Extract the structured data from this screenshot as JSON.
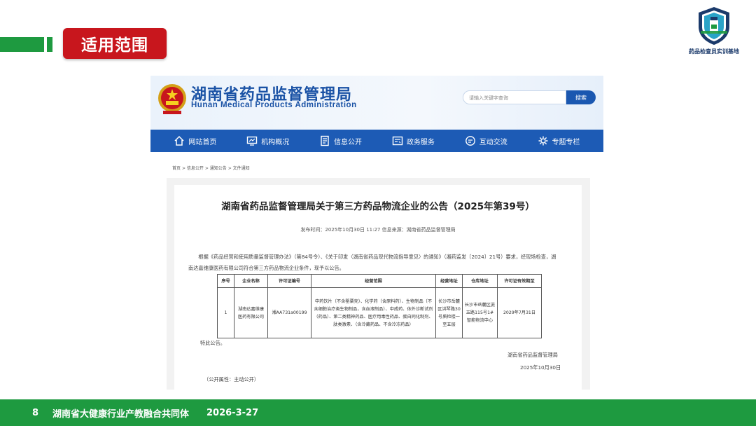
{
  "slide": {
    "section_tag": "适用范围",
    "logo_text": "药品检查员实训基地",
    "footer": {
      "page": "8",
      "org": "湖南省大健康行业产教融合共同体",
      "date": "2026-3-27"
    }
  },
  "site": {
    "title": "湖南省药品监督管理局",
    "subtitle": "Hunan Medical Products Administration",
    "search_placeholder": "请输入关键字查询",
    "search_button": "搜索",
    "nav": [
      {
        "label": "网站首页",
        "icon": "home-icon"
      },
      {
        "label": "机构概况",
        "icon": "monitor-icon"
      },
      {
        "label": "信息公开",
        "icon": "document-icon"
      },
      {
        "label": "政务服务",
        "icon": "service-icon"
      },
      {
        "label": "互动交流",
        "icon": "chat-icon"
      },
      {
        "label": "专题专栏",
        "icon": "gear-icon"
      }
    ],
    "breadcrumb": [
      "首页",
      "信息公开",
      "通知公告",
      "文件通知"
    ],
    "breadcrumb_sep": ">"
  },
  "article": {
    "title": "湖南省药品监督管理局关于第三方药品物流企业的公告（2025年第39号）",
    "meta": "发布时间：2025年10月30日 11:27 信息来源：湖南省药品监督管理局",
    "body": "根据《药品经营和使用质量监督管理办法》（第84号令）、《关于印发〈湖南省药品现代物流指导意见〉的通知》（湘药监发〔2024〕21号）要求，经现场检查，湖南达嘉维康医药有限公司符合第三方药品物流企业条件，现予以公告。",
    "table": {
      "headers": [
        "序号",
        "企业名称",
        "许可证编号",
        "经营范围",
        "经营地址",
        "仓库地址",
        "许可证有效期至"
      ],
      "rows": [
        [
          "1",
          "湖南达嘉维康医药有限公司",
          "湘AA731a00199",
          "中药饮片（不含罂粟壳）、化学药（含原料药）、生物制品（不含细胞治疗类生物制品，含血液制品）、中成药、体外诊断试剂（药品）、第二类精神药品、医疗用毒性药品、蛋白同化制剂、肽类激素、（含冷藏药品、不含冷冻药品）",
          "长沙市岳麓区洪琴路30号质检楼一至五层",
          "长沙市岳麓区茈玉路115号1#智能物流中心",
          "2029年7月31日"
        ]
      ]
    },
    "closing": "特此公告。",
    "signer": "湖南省药品监督管理局",
    "sign_date": "2025年10月30日",
    "open_attribute": "（公开属性：主动公开）"
  },
  "colors": {
    "brand_green": "#1e9a40",
    "tag_red": "#c8161d",
    "site_blue": "#1d5bb5"
  }
}
